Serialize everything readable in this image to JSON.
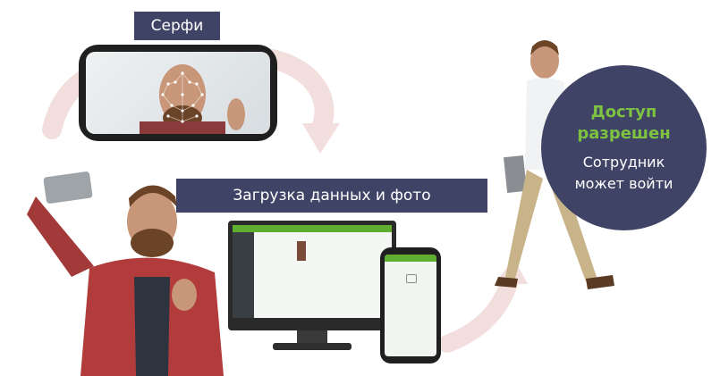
{
  "labels": {
    "selfie": "Серфи",
    "upload": "Загрузка данных и фото"
  },
  "access": {
    "title_line1": "Доступ",
    "title_line2": "разрешен",
    "sub_line1": "Сотрудник",
    "sub_line2": "может войти"
  },
  "colors": {
    "label_bg": "#3f4466",
    "accent_green": "#7dc241",
    "arrow": "#f3dede"
  },
  "icons": [
    "selfie-photo",
    "face-mesh",
    "curved-arrow",
    "desktop-monitor",
    "smartphone",
    "walking-man"
  ]
}
